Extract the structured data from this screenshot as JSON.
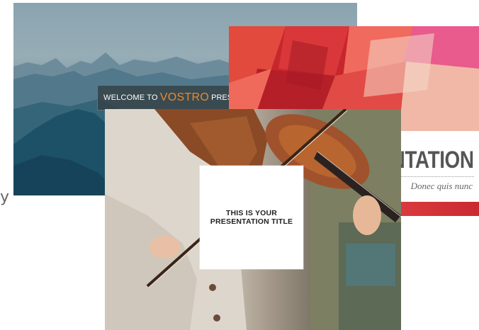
{
  "stray_glyph": "y",
  "slides": [
    {
      "welcome_text": "WELCOME TO",
      "brand": "VOSTRO",
      "after_text": "PRESE",
      "accent_color": "#e98a2e"
    },
    {
      "title_fragment": "NTATION",
      "subtitle_fragment": "Donec quis nunc",
      "accent_color": "#c82a2a"
    },
    {
      "title_line1": "THIS IS YOUR",
      "title_line2": "PRESENTATION TITLE"
    }
  ]
}
